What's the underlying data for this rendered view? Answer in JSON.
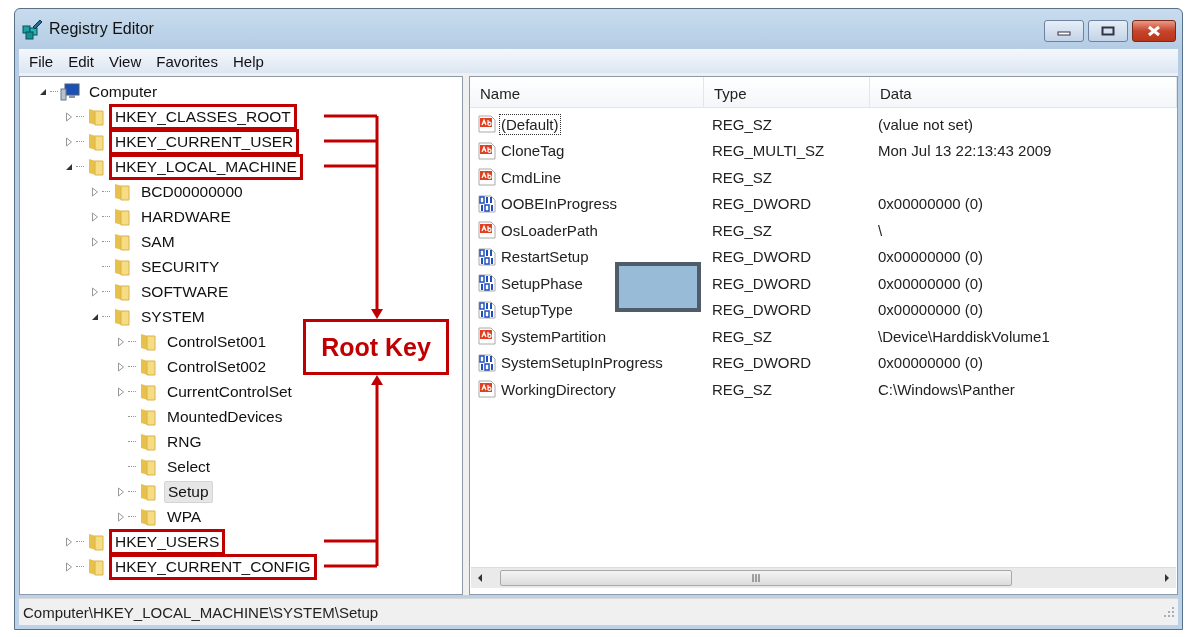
{
  "window": {
    "title": "Registry Editor"
  },
  "menu": [
    {
      "label": "File"
    },
    {
      "label": "Edit"
    },
    {
      "label": "View"
    },
    {
      "label": "Favorites"
    },
    {
      "label": "Help"
    }
  ],
  "tree": [
    {
      "label": "Computer",
      "kind": "computer",
      "expanded": true,
      "selected": false,
      "marked": false,
      "children": [
        {
          "label": "HKEY_CLASSES_ROOT",
          "kind": "folder",
          "expanded": false,
          "selected": false,
          "marked": true
        },
        {
          "label": "HKEY_CURRENT_USER",
          "kind": "folder",
          "expanded": false,
          "selected": false,
          "marked": true
        },
        {
          "label": "HKEY_LOCAL_MACHINE",
          "kind": "folder",
          "expanded": true,
          "selected": false,
          "marked": true,
          "children": [
            {
              "label": "BCD00000000",
              "kind": "folder",
              "expanded": false,
              "selected": false,
              "marked": false
            },
            {
              "label": "HARDWARE",
              "kind": "folder",
              "expanded": false,
              "selected": false,
              "marked": false
            },
            {
              "label": "SAM",
              "kind": "folder",
              "expanded": false,
              "selected": false,
              "marked": false
            },
            {
              "label": "SECURITY",
              "kind": "folder",
              "selected": false,
              "marked": false
            },
            {
              "label": "SOFTWARE",
              "kind": "folder",
              "expanded": false,
              "selected": false,
              "marked": false
            },
            {
              "label": "SYSTEM",
              "kind": "folder",
              "expanded": true,
              "selected": false,
              "marked": false,
              "children": [
                {
                  "label": "ControlSet001",
                  "kind": "folder",
                  "expanded": false,
                  "selected": false,
                  "marked": false
                },
                {
                  "label": "ControlSet002",
                  "kind": "folder",
                  "expanded": false,
                  "selected": false,
                  "marked": false
                },
                {
                  "label": "CurrentControlSet",
                  "kind": "folder",
                  "expanded": false,
                  "selected": false,
                  "marked": false
                },
                {
                  "label": "MountedDevices",
                  "kind": "folder",
                  "selected": false,
                  "marked": false
                },
                {
                  "label": "RNG",
                  "kind": "folder",
                  "selected": false,
                  "marked": false
                },
                {
                  "label": "Select",
                  "kind": "folder",
                  "selected": false,
                  "marked": false
                },
                {
                  "label": "Setup",
                  "kind": "folder",
                  "expanded": false,
                  "selected": true,
                  "marked": false
                },
                {
                  "label": "WPA",
                  "kind": "folder",
                  "expanded": false,
                  "selected": false,
                  "marked": false
                }
              ]
            }
          ]
        },
        {
          "label": "HKEY_USERS",
          "kind": "folder",
          "expanded": false,
          "selected": false,
          "marked": true
        },
        {
          "label": "HKEY_CURRENT_CONFIG",
          "kind": "folder",
          "expanded": false,
          "selected": false,
          "marked": true
        }
      ]
    }
  ],
  "callout": {
    "text": "Root Key"
  },
  "table": {
    "columns": [
      "Name",
      "Type",
      "Data"
    ],
    "rows": [
      {
        "kind": "string",
        "focused": true,
        "name": "(Default)",
        "type": "REG_SZ",
        "data": "(value not set)"
      },
      {
        "kind": "string",
        "focused": false,
        "name": "CloneTag",
        "type": "REG_MULTI_SZ",
        "data": "Mon Jul 13 22:13:43 2009"
      },
      {
        "kind": "string",
        "focused": false,
        "name": "CmdLine",
        "type": "REG_SZ",
        "data": ""
      },
      {
        "kind": "binary",
        "focused": false,
        "name": "OOBEInProgress",
        "type": "REG_DWORD",
        "data": "0x00000000 (0)"
      },
      {
        "kind": "string",
        "focused": false,
        "name": "OsLoaderPath",
        "type": "REG_SZ",
        "data": "\\"
      },
      {
        "kind": "binary",
        "focused": false,
        "name": "RestartSetup",
        "type": "REG_DWORD",
        "data": "0x00000000 (0)"
      },
      {
        "kind": "binary",
        "focused": false,
        "name": "SetupPhase",
        "type": "REG_DWORD",
        "data": "0x00000000 (0)"
      },
      {
        "kind": "binary",
        "focused": false,
        "name": "SetupType",
        "type": "REG_DWORD",
        "data": "0x00000000 (0)"
      },
      {
        "kind": "string",
        "focused": false,
        "name": "SystemPartition",
        "type": "REG_SZ",
        "data": "\\Device\\HarddiskVolume1"
      },
      {
        "kind": "binary",
        "focused": false,
        "name": "SystemSetupInProgress",
        "type": "REG_DWORD",
        "data": "0x00000000 (0)"
      },
      {
        "kind": "string",
        "focused": false,
        "name": "WorkingDirectory",
        "type": "REG_SZ",
        "data": "C:\\Windows\\Panther"
      }
    ]
  },
  "status_bar": {
    "path": "Computer\\HKEY_LOCAL_MACHINE\\SYSTEM\\Setup"
  }
}
